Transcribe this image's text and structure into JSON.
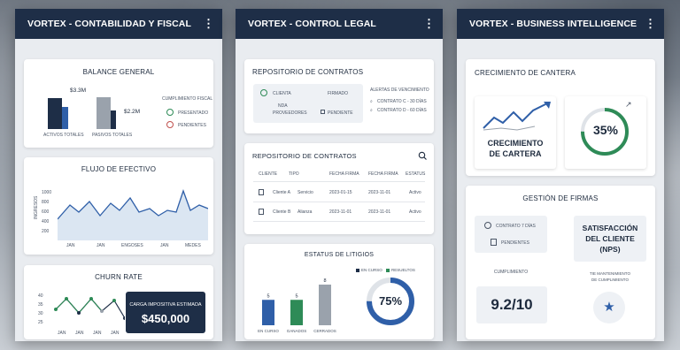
{
  "colors": {
    "navy": "#1e2e47",
    "green": "#2e8b57",
    "blue": "#2f5fa8",
    "gray": "#9aa2ac",
    "red": "#c0504d"
  },
  "panel1": {
    "title": "VORTEX - CONTABILIDAD Y FISCAL",
    "balance": {
      "title": "BALANCE GENERAL",
      "bar1_value": "$3.3M",
      "bar1_label": "ACTIVOS TOTALES",
      "bar2_value": "$2.2M",
      "bar2_label": "PASIVOS TOTALES",
      "fiscal_title": "CUMPLIMIENTO FISCAL",
      "fiscal_item1": "PRESENTADO",
      "fiscal_item2": "PENDIENTES"
    },
    "flujo": {
      "title": "FLUJO DE EFECTIVO",
      "ylabel": "INGRESOS",
      "yticks": [
        "1000",
        "800",
        "600",
        "400",
        "200"
      ],
      "xticks": [
        "JAN",
        "JAN",
        "ENGOSES",
        "JAN",
        "MEDES"
      ]
    },
    "churn": {
      "title": "CHURN RATE",
      "yticks": [
        "40",
        "35",
        "30",
        "25",
        "20"
      ],
      "xticks": [
        "JAN",
        "JAN",
        "JAN",
        "JAN"
      ],
      "caption": "CARGA IMPOSITIVA ESTIMADA",
      "amount": "$450,000"
    }
  },
  "panel2": {
    "title": "VORTEX - CONTROL LEGAL",
    "repo1": {
      "title": "REPOSITORIO DE CONTRATOS",
      "item1": "CLIENTA",
      "item1_status": "FIRMADO",
      "item2": "NDA",
      "item2b": "PROVEEDORES",
      "item2_status": "PENDIENTE",
      "alerts_title": "ALERTAS DE VENCIMIENTO",
      "alert1": "CONTRATO C - 30 DÍAS",
      "alert2": "CONTRATO D - 60 DÍAS"
    },
    "repo2": {
      "title": "REPOSITORIO DE CONTRATOS",
      "headers": [
        "CLIENTE",
        "TIPO",
        "FECHA FIRMA",
        "FECHA FIRMA",
        "ESTATUS"
      ],
      "rows": [
        {
          "client": "Cliente A",
          "type": "Servicio",
          "date1": "2023-01-15",
          "date2": "2023-11-01",
          "status": "Activo"
        },
        {
          "client": "Cliente B",
          "type": "Alianza",
          "date1": "2023-11-01",
          "date2": "2023-11-01",
          "status": "Activo"
        }
      ]
    },
    "litigios": {
      "title": "ESTATUS DE LITIGIOS",
      "legend1": "EN CURSO",
      "legend2": "RESUELTOS",
      "bars": [
        {
          "label": "EN CURSO",
          "value": 5
        },
        {
          "label": "GANADOS",
          "value": 5
        },
        {
          "label": "CERRADOS",
          "value": 8
        }
      ],
      "donut_value": "75%",
      "donut_fraction": 0.75
    }
  },
  "panel3": {
    "title": "VORTEX - BUSINESS INTELLIGENCE",
    "cantera": {
      "title": "CRECIMIENTO DE CANTERA",
      "subtitle_line1": "CRECIMIENTO",
      "subtitle_line2": "DE CARTERA",
      "gauge_value": "35%",
      "gauge_fraction": 0.75
    },
    "firmas": {
      "title": "GESTIÓN DE FIRMAS",
      "item1": "CONTRATO 7 DÍAS",
      "item2": "PENDIENTES",
      "nps_line1": "SATISFACCIÓN",
      "nps_line2": "DEL CLIENTE",
      "nps_line3": "(NPS)",
      "score_label": "CUMPLIMIENTO",
      "score": "9.2/10",
      "right_label_line1": "TIE MANTENIMIENTO",
      "right_label_line2": "DE CUMPLIMIENTO"
    }
  }
}
